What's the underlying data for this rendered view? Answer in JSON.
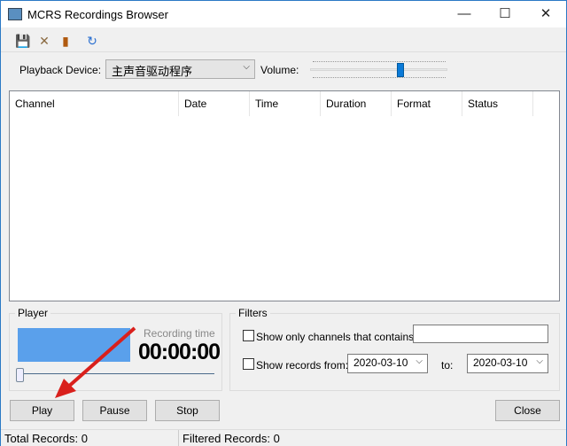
{
  "window": {
    "title": "MCRS Recordings Browser",
    "minimize": "—",
    "maximize": "☐",
    "close": "✕"
  },
  "toolbar": {
    "items": [
      {
        "icon": "save-icon",
        "glyph": "💾"
      },
      {
        "icon": "delete-icon",
        "glyph": "✕"
      },
      {
        "icon": "audio-icon",
        "glyph": "▮"
      },
      {
        "icon": "refresh-icon",
        "glyph": "↻"
      }
    ]
  },
  "device": {
    "label": "Playback Device:",
    "value": "主声音驱动程序",
    "volume_label": "Volume:",
    "volume_level": 0.68
  },
  "list": {
    "columns": [
      "Channel",
      "Date",
      "Time",
      "Duration",
      "Format",
      "Status"
    ],
    "rows": []
  },
  "player": {
    "title": "Player",
    "recording_time_label": "Recording time",
    "clock": "00:00:00",
    "position": 0
  },
  "filters": {
    "title": "Filters",
    "channel_label": "Show only channels that contains:",
    "channel_value": "",
    "channel_checked": false,
    "records_label": "Show records from:",
    "records_checked": false,
    "from": "2020-03-10",
    "to_label": "to:",
    "to": "2020-03-10"
  },
  "buttons": {
    "play": "Play",
    "pause": "Pause",
    "stop": "Stop",
    "close": "Close"
  },
  "status": {
    "total": "Total Records: 0",
    "filtered": "Filtered Records: 0"
  },
  "colors": {
    "preview": "#5aa0eb",
    "volume_thumb": "#0a7ad8",
    "annotation_arrow": "#d9201c"
  }
}
